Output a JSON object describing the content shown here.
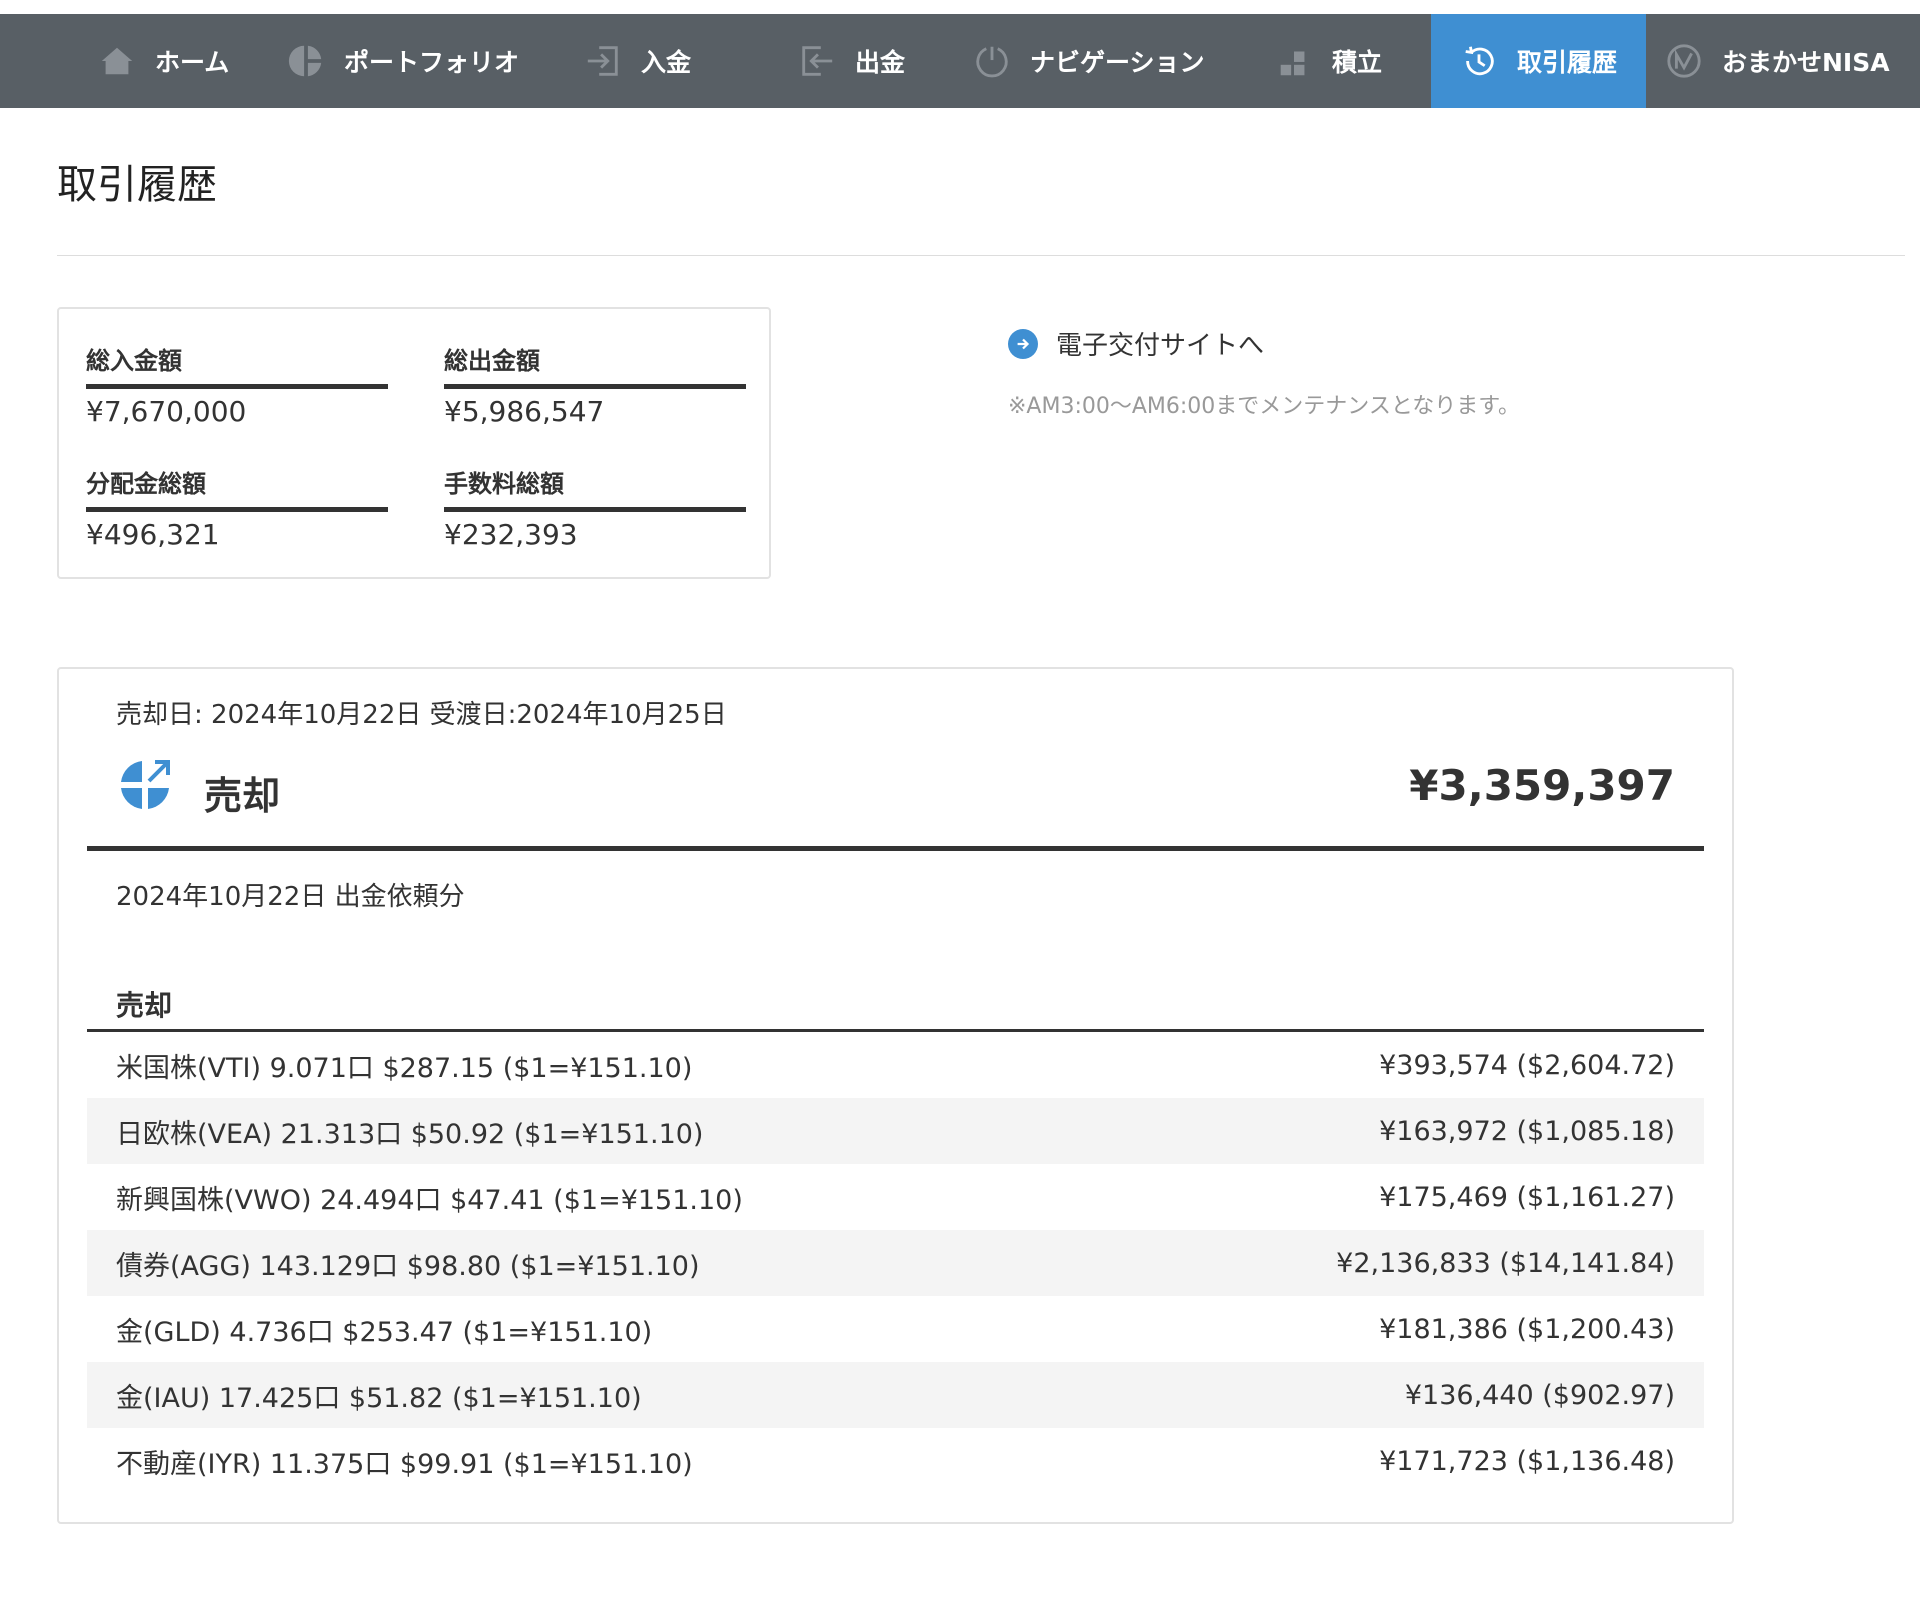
{
  "nav": {
    "items": [
      {
        "label": "ホーム",
        "icon": "home-icon"
      },
      {
        "label": "ポートフォリオ",
        "icon": "pie-chart-icon"
      },
      {
        "label": "入金",
        "icon": "deposit-icon"
      },
      {
        "label": "出金",
        "icon": "withdraw-icon"
      },
      {
        "label": "ナビゲーション",
        "icon": "navigation-icon"
      },
      {
        "label": "積立",
        "icon": "accumulate-icon"
      },
      {
        "label": "取引履歴",
        "icon": "history-icon",
        "active": true
      },
      {
        "label": "おまかせNISA",
        "icon": "nisa-icon"
      }
    ],
    "active_color": "#3f8fd2",
    "bg_color": "#585f65"
  },
  "page": {
    "title": "取引履歴"
  },
  "summary": {
    "deposit_label": "総入金額",
    "deposit_value": "¥7,670,000",
    "withdraw_label": "総出金額",
    "withdraw_value": "¥5,986,547",
    "dividend_label": "分配金総額",
    "dividend_value": "¥496,321",
    "fee_label": "手数料総額",
    "fee_value": "¥232,393"
  },
  "esite": {
    "link_label": "電子交付サイトへ",
    "note": "※AM3:00〜AM6:00までメンテナンスとなります。"
  },
  "trade": {
    "dates": "売却日: 2024年10月22日 受渡日:2024年10月25日",
    "type_label": "売却",
    "total": "¥3,359,397",
    "request": "2024年10月22日 出金依頼分",
    "section_heading": "売却",
    "rows": [
      {
        "desc": "米国株(VTI) 9.071口 $287.15 ($1=¥151.10)",
        "amount": "¥393,574 ($2,604.72)"
      },
      {
        "desc": "日欧株(VEA) 21.313口 $50.92 ($1=¥151.10)",
        "amount": "¥163,972 ($1,085.18)"
      },
      {
        "desc": "新興国株(VWO) 24.494口 $47.41 ($1=¥151.10)",
        "amount": "¥175,469 ($1,161.27)"
      },
      {
        "desc": "債券(AGG) 143.129口 $98.80 ($1=¥151.10)",
        "amount": "¥2,136,833 ($14,141.84)"
      },
      {
        "desc": "金(GLD) 4.736口 $253.47 ($1=¥151.10)",
        "amount": "¥181,386 ($1,200.43)"
      },
      {
        "desc": "金(IAU) 17.425口 $51.82 ($1=¥151.10)",
        "amount": "¥136,440 ($902.97)"
      },
      {
        "desc": "不動産(IYR) 11.375口 $99.91 ($1=¥151.10)",
        "amount": "¥171,723 ($1,136.48)"
      }
    ]
  }
}
